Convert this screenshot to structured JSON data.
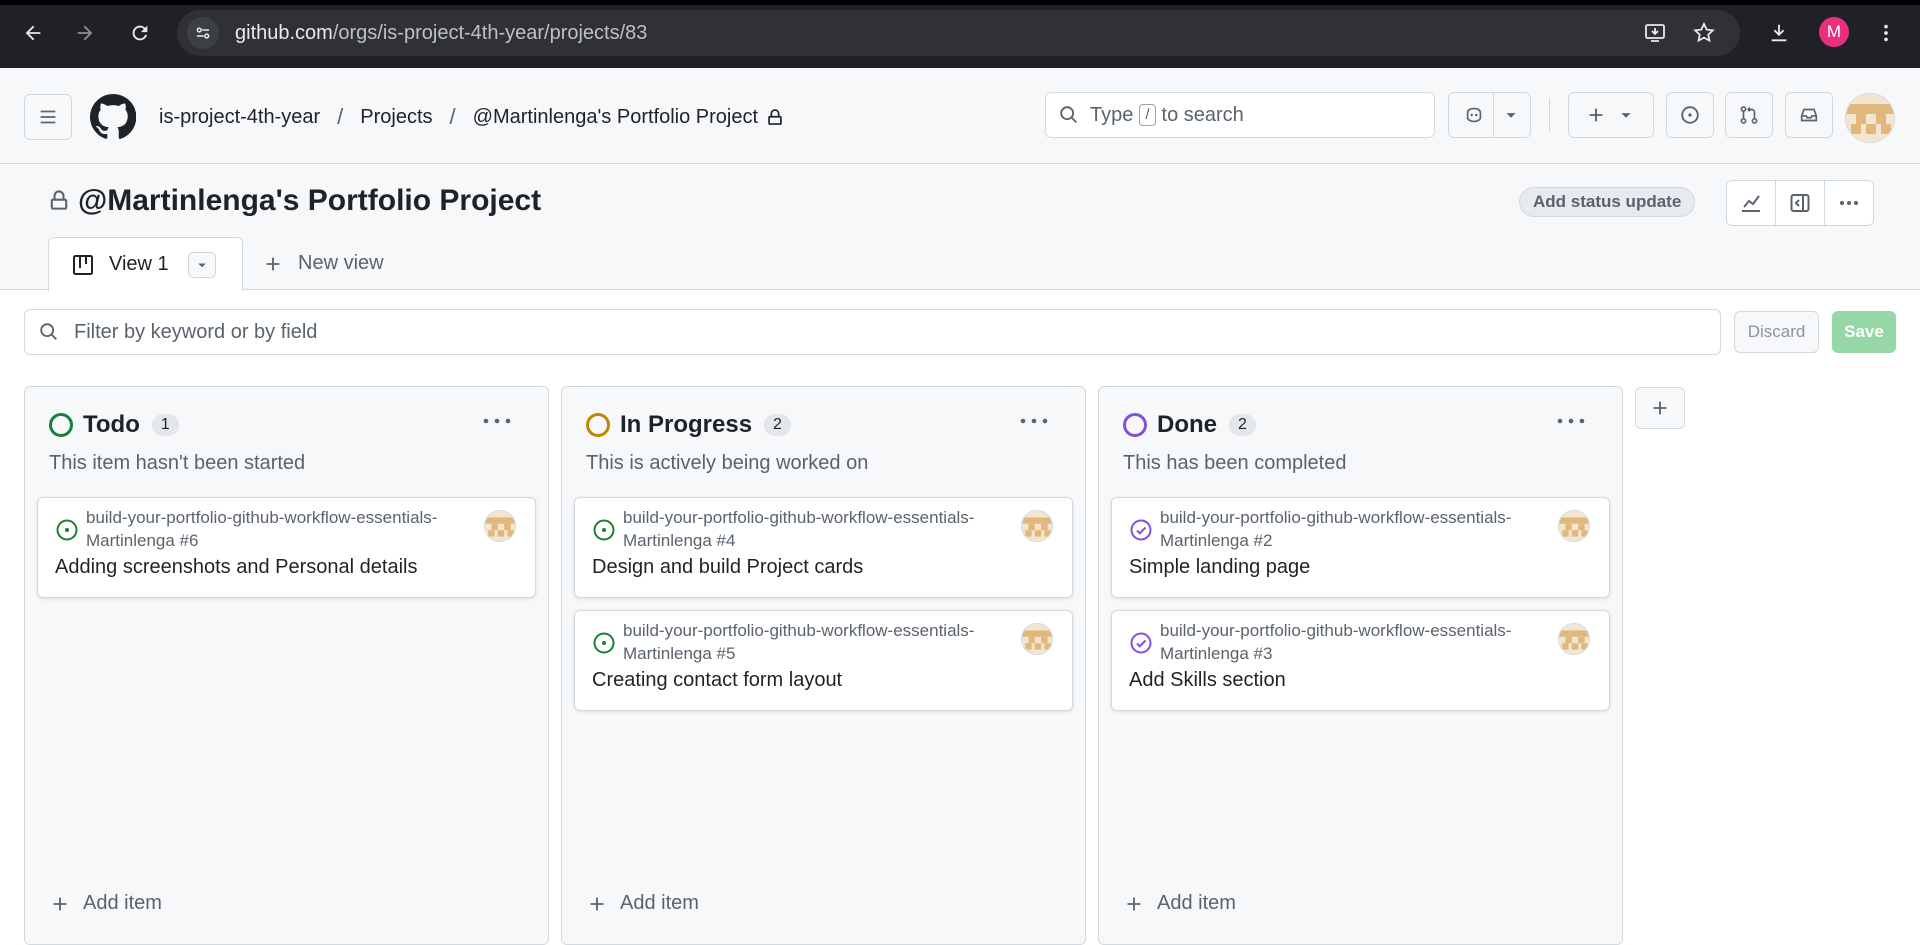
{
  "browser": {
    "url_host": "github.com",
    "url_path": "/orgs/is-project-4th-year/projects/83",
    "profile_initial": "M"
  },
  "header": {
    "breadcrumbs": [
      "is-project-4th-year",
      "Projects",
      "@Martinlenga's Portfolio Project"
    ],
    "search_prefix": "Type",
    "search_key": "/",
    "search_suffix": "to search"
  },
  "project": {
    "title": "@Martinlenga's Portfolio Project",
    "status_button": "Add status update",
    "view_tab": "View 1",
    "new_view": "New view"
  },
  "filter": {
    "placeholder": "Filter by keyword or by field",
    "discard": "Discard",
    "save": "Save"
  },
  "columns": [
    {
      "name": "Todo",
      "count": "1",
      "description": "This item hasn't been started",
      "color": "#1a7f37",
      "add_item": "Add item",
      "cards": [
        {
          "repo": "build-your-portfolio-github-workflow-essentials-Martinlenga #6",
          "title": "Adding screenshots and Personal details",
          "state": "open"
        }
      ]
    },
    {
      "name": "In Progress",
      "count": "2",
      "description": "This is actively being worked on",
      "color": "#bf8700",
      "add_item": "Add item",
      "cards": [
        {
          "repo": "build-your-portfolio-github-workflow-essentials-Martinlenga #4",
          "title": "Design and build Project cards",
          "state": "open"
        },
        {
          "repo": "build-your-portfolio-github-workflow-essentials-Martinlenga #5",
          "title": "Creating contact form layout",
          "state": "open"
        }
      ]
    },
    {
      "name": "Done",
      "count": "2",
      "description": "This has been completed",
      "color": "#8250df",
      "add_item": "Add item",
      "cards": [
        {
          "repo": "build-your-portfolio-github-workflow-essentials-Martinlenga #2",
          "title": "Simple landing page",
          "state": "closed"
        },
        {
          "repo": "build-your-portfolio-github-workflow-essentials-Martinlenga #3",
          "title": "Add Skills section",
          "state": "closed"
        }
      ]
    }
  ]
}
